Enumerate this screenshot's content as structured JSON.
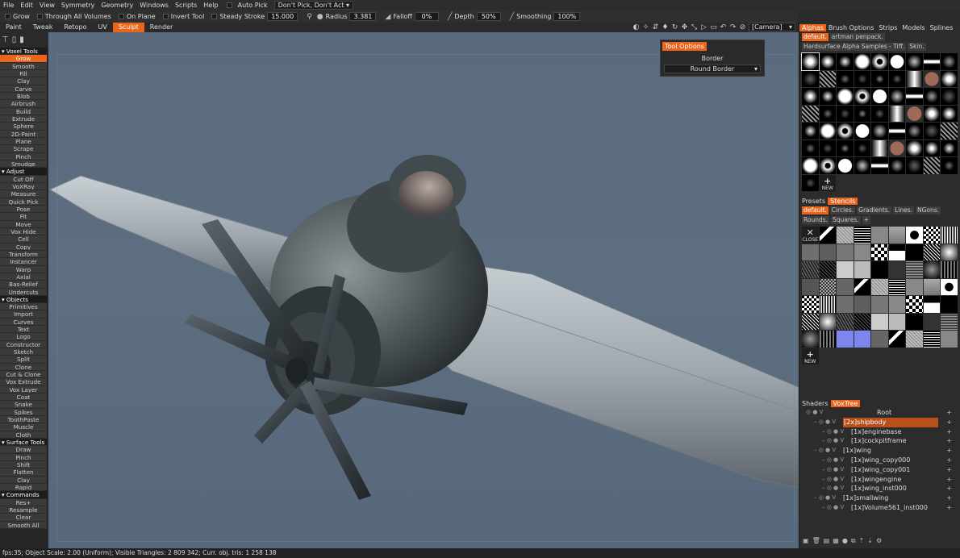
{
  "menu": {
    "items": [
      "File",
      "Edit",
      "View",
      "Symmetry",
      "Geometry",
      "Windows",
      "Scripts",
      "Help"
    ],
    "auto_pick_label": "Auto Pick",
    "pick_mode_value": "Don't Pick, Don't Act"
  },
  "toolbar": {
    "grow": "Grow",
    "through_all_volumes": "Through All Volumes",
    "on_plane": "On Plane",
    "invert_tool": "Invert Tool",
    "steady_stroke_label": "Steady Stroke",
    "steady_stroke_value": "15.000",
    "radius_label": "Radius",
    "radius_value": "3.381",
    "falloff_label": "Falloff",
    "falloff_value": "0%",
    "depth_label": "Depth",
    "depth_value": "50%",
    "smoothing_label": "Smoothing",
    "smoothing_value": "100%"
  },
  "mode_tabs": [
    "Paint",
    "Tweak",
    "Retopo",
    "UV",
    "Sculpt",
    "Render"
  ],
  "active_mode_tab": "Sculpt",
  "camera_value": "[Camera]",
  "tool_sections": [
    {
      "header": "Voxel Tools",
      "items": [
        "Grow",
        "Smooth",
        "Fill",
        "Clay",
        "Carve",
        "Blob",
        "Airbrush",
        "Build",
        "Extrude",
        "Sphere",
        "2D-Paint",
        "Plane",
        "Scrape",
        "Pinch",
        "Smudge"
      ]
    },
    {
      "header": "Adjust",
      "items": [
        "Cut Off",
        "VoXRay",
        "Measure",
        "Quick Pick",
        "Pose",
        "Fit",
        "Move",
        "Vox Hide",
        "Cell",
        "Copy",
        "Transform",
        "Instancer",
        "Warp",
        "Axial",
        "Bas-Relief",
        "Undercuts"
      ]
    },
    {
      "header": "Objects",
      "items": [
        "Primitives",
        "Import",
        "Curves",
        "Text",
        "Logo",
        "Constructor",
        "Sketch",
        "Split",
        "Clone",
        "Cut & Clone",
        "Vox Extrude",
        "Vox Layer",
        "Coat",
        "Snake",
        "Spikes",
        "ToothPaste",
        "Muscle",
        "Cloth"
      ]
    },
    {
      "header": "Surface Tools",
      "items": [
        "Draw",
        "Pinch",
        "Shift",
        "Flatten",
        "Clay",
        "Rapid"
      ]
    },
    {
      "header": "Commands",
      "items": [
        "Res+",
        "Resample",
        "Clear",
        "Smooth All"
      ]
    }
  ],
  "active_tool": "Grow",
  "tool_options": {
    "title": "Tool Options",
    "border_label": "Border",
    "border_value": "Round Border"
  },
  "right_panel": {
    "top_tabs": [
      "Alphas",
      "Brush Options",
      "Strips",
      "Models",
      "Splines"
    ],
    "top_active": "Alphas",
    "alpha_presets": [
      "default.",
      "artman penpack."
    ],
    "alpha_presets_row2": [
      "Hardsurface Alpha Samples - Tiff.",
      "Skin."
    ],
    "alpha_new_label": "NEW",
    "stencil_tabs": [
      "Presets",
      "Stencils"
    ],
    "stencil_active": "Stencils",
    "stencil_presets": [
      "default.",
      "Circles.",
      "Gradients.",
      "Lines.",
      "NGons.",
      "Rounds.",
      "Squares."
    ],
    "stencil_close_label": "CLOSE",
    "stencil_new_label": "NEW",
    "tree_tabs": [
      "Shaders",
      "VoxTree"
    ],
    "tree_active": "VoxTree"
  },
  "voxtree": [
    {
      "name": "Root",
      "level": 0,
      "selected": false
    },
    {
      "name": "[2x]shipbody",
      "level": 1,
      "selected": true
    },
    {
      "name": "[1x]enginebase",
      "level": 2,
      "selected": false
    },
    {
      "name": "[1x]cockpitframe",
      "level": 2,
      "selected": false
    },
    {
      "name": "[1x]wing",
      "level": 1,
      "selected": false
    },
    {
      "name": "[1x]wing_copy000",
      "level": 2,
      "selected": false
    },
    {
      "name": "[1x]wing_copy001",
      "level": 2,
      "selected": false
    },
    {
      "name": "[1x]wingengine",
      "level": 2,
      "selected": false
    },
    {
      "name": "[1x]wing_inst000",
      "level": 2,
      "selected": false
    },
    {
      "name": "[1x]smallwing",
      "level": 1,
      "selected": false
    },
    {
      "name": "[1x]Volume561_inst000",
      "level": 2,
      "selected": false
    }
  ],
  "status": "fps:35;    Object Scale: 2.00 (Uniform); Visible Triangles: 2 809 342; Curr. obj. tris: 1 258 138",
  "colors": {
    "accent": "#e9651c",
    "viewport": "#5b6c7f",
    "panel": "#2c2c2c"
  }
}
